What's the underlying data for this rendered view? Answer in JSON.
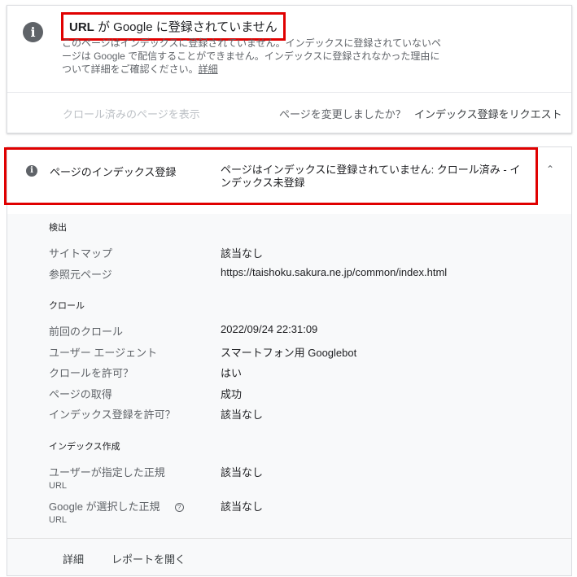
{
  "top_card": {
    "icon": "info-icon",
    "title_prefix": "URL",
    "title_main": " が Google に登録されていません",
    "description": "このページはインデックスに登録されていません。インデックスに登録されていないページは Google で配信することができません。インデックスに登録されなかった理由について詳細をご確認ください。",
    "details_link": "詳細",
    "view_crawled": "クロール済みのページを表示",
    "changed_question": "ページを変更しましたか？",
    "request_indexing": "インデックス登録をリクエスト"
  },
  "coverage": {
    "icon": "info-icon",
    "title": "ページのインデックス登録",
    "status": "ページはインデックスに登録されていません: クロール済み - インデックス未登録",
    "expand_icon": "chevron-up-icon"
  },
  "discovery": {
    "heading": "検出",
    "sitemap_label": "サイトマップ",
    "sitemap_value": "該当なし",
    "referring_label": "参照元ページ",
    "referring_value": "https://taishoku.sakura.ne.jp/common/index.html"
  },
  "crawl": {
    "heading": "クロール",
    "last_crawl_label": "前回のクロール",
    "last_crawl_value": "2022/09/24 22:31:09",
    "agent_label": "ユーザー エージェント",
    "agent_value": "スマートフォン用 Googlebot",
    "allowed_label": "クロールを許可？",
    "allowed_value": "はい",
    "fetch_label": "ページの取得",
    "fetch_value": "成功",
    "index_allowed_label": "インデックス登録を許可？",
    "index_allowed_value": "該当なし"
  },
  "indexing": {
    "heading": "インデックス作成",
    "user_canonical_label": "ユーザーが指定した正規",
    "user_canonical_sub": "URL",
    "user_canonical_value": "該当なし",
    "google_canonical_label": "Google が選択した正規",
    "google_canonical_sub": "URL",
    "google_canonical_value": "該当なし",
    "help_icon": "help-icon"
  },
  "footer": {
    "details": "詳細",
    "open_report": "レポートを開く"
  },
  "colors": {
    "highlight": "#e00000",
    "icon_gray": "#5f6368",
    "panel_bg": "#f8f9fa"
  }
}
